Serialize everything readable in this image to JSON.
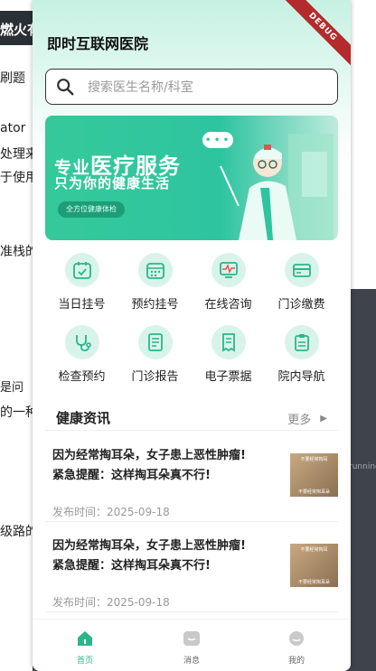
{
  "background": {
    "left_lines": [
      "燃火有",
      "刷题",
      "ator",
      "处理来",
      "于使用",
      "准栈的",
      "是问",
      "的一种",
      "级路的"
    ],
    "right_snippet": "running"
  },
  "debug_label": "DEBUG",
  "header": {
    "title": "即时互联网医院"
  },
  "search": {
    "placeholder": "搜索医生名称/科室",
    "icon": "search-icon"
  },
  "banner": {
    "line1_prefix": "专业",
    "line1_big": "医疗服务",
    "line2": "只为你的健康生活",
    "pill": "全方位健康体检",
    "bubble": "• • •",
    "colors": {
      "primary": "#35c99a",
      "dark": "#1d9e76"
    }
  },
  "services": [
    {
      "label": "当日挂号",
      "icon": "calendar-check-icon"
    },
    {
      "label": "预约挂号",
      "icon": "calendar-grid-icon"
    },
    {
      "label": "在线咨询",
      "icon": "monitor-pulse-icon"
    },
    {
      "label": "门诊缴费",
      "icon": "card-icon"
    },
    {
      "label": "检查预约",
      "icon": "stethoscope-icon"
    },
    {
      "label": "门诊报告",
      "icon": "report-icon"
    },
    {
      "label": "电子票据",
      "icon": "receipt-icon"
    },
    {
      "label": "院内导航",
      "icon": "clipboard-icon"
    }
  ],
  "news": {
    "title": "健康资讯",
    "more": "更多",
    "items": [
      {
        "line1": "因为经常掏耳朵，女子患上恶性肿瘤!",
        "line2": "紧急提醒：这样掏耳朵真不行!",
        "date": "发布时间：2025-09-18",
        "thumb_top": "不要经常掏耳",
        "thumb_bottom": "不要经常掏耳朵"
      },
      {
        "line1": "因为经常掏耳朵，女子患上恶性肿瘤!",
        "line2": "紧急提醒：这样掏耳朵真不行!",
        "date": "发布时间：2025-09-18",
        "thumb_top": "不要经常掏耳",
        "thumb_bottom": "不要经常掏耳朵"
      }
    ]
  },
  "tabbar": [
    {
      "label": "首页",
      "icon": "home-icon",
      "active": true
    },
    {
      "label": "消息",
      "icon": "message-icon",
      "active": false
    },
    {
      "label": "我的",
      "icon": "profile-icon",
      "active": false
    }
  ],
  "accent_color": "#2bb58a"
}
